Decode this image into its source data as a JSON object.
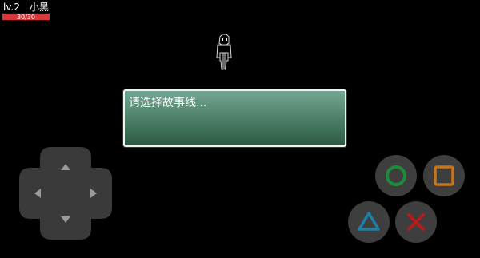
{
  "hud": {
    "level": "lv.2",
    "player_name": "小黑",
    "hp_text": "30/30",
    "hp_fraction": 1.0,
    "hp_color": "#d9383a"
  },
  "dialog": {
    "text": "请选择故事线..."
  },
  "dpad": {
    "up_icon": "arrow-up-icon",
    "down_icon": "arrow-down-icon",
    "left_icon": "arrow-left-icon",
    "right_icon": "arrow-right-icon"
  },
  "actions": {
    "circle": {
      "icon": "circle-icon",
      "color": "#1f8a3a"
    },
    "square": {
      "icon": "square-icon",
      "color": "#c8741a"
    },
    "triangle": {
      "icon": "triangle-icon",
      "color": "#1e7fa6"
    },
    "cross": {
      "icon": "cross-icon",
      "color": "#b51c1c"
    }
  }
}
